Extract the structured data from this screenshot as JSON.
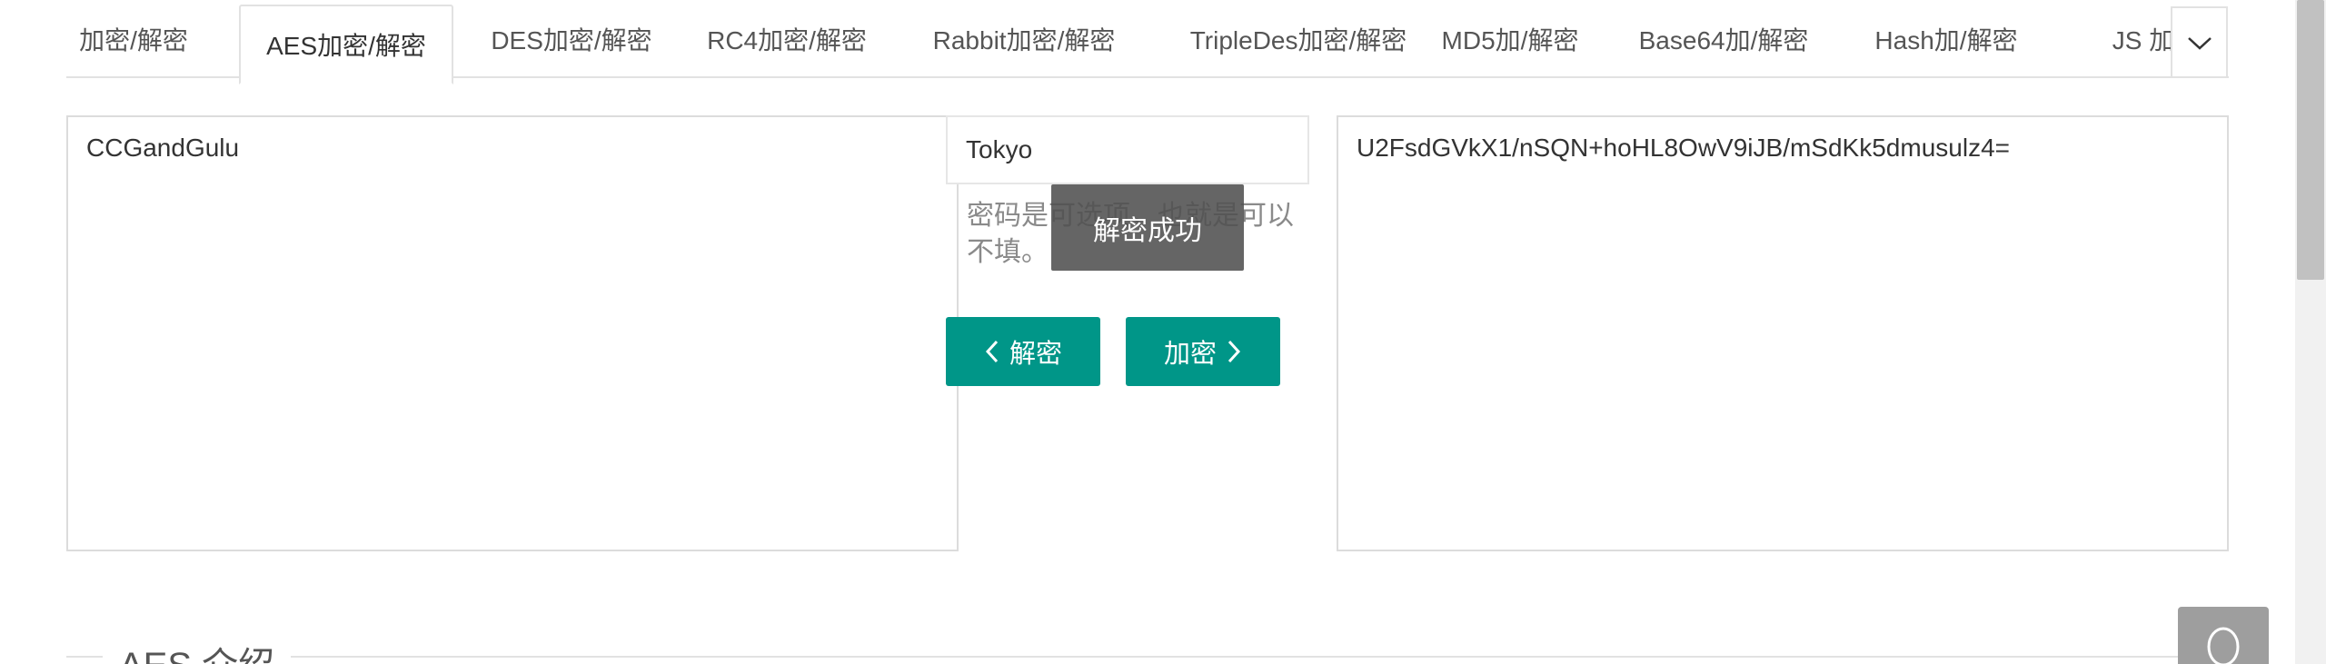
{
  "tabs": [
    {
      "label": "加密/解密",
      "active": false
    },
    {
      "label": "AES加密/解密",
      "active": true
    },
    {
      "label": "DES加密/解密",
      "active": false
    },
    {
      "label": "RC4加密/解密",
      "active": false
    },
    {
      "label": "Rabbit加密/解密",
      "active": false
    },
    {
      "label": "TripleDes加密/解密",
      "active": false
    },
    {
      "label": "MD5加/解密",
      "active": false
    },
    {
      "label": "Base64加/解密",
      "active": false
    },
    {
      "label": "Hash加/解密",
      "active": false
    },
    {
      "label": "JS 加密",
      "active": false
    }
  ],
  "tab_more_icon": "chevron-down-icon",
  "input": {
    "plaintext": "CCGandGulu",
    "password": "Tokyo",
    "password_hint": "密码是可选项，也就是可以不填。",
    "ciphertext": "U2FsdGVkX1/nSQN+hoHL8OwV9iJB/mSdKk5dmusulz4="
  },
  "buttons": {
    "decrypt_label": "解密",
    "encrypt_label": "加密"
  },
  "toast": "解密成功",
  "section": {
    "title": "AES 介绍"
  },
  "colors": {
    "accent": "#009688",
    "toast_bg": "#505050",
    "border": "#e2e2e2"
  },
  "float_button_icon": "support-chat-icon"
}
